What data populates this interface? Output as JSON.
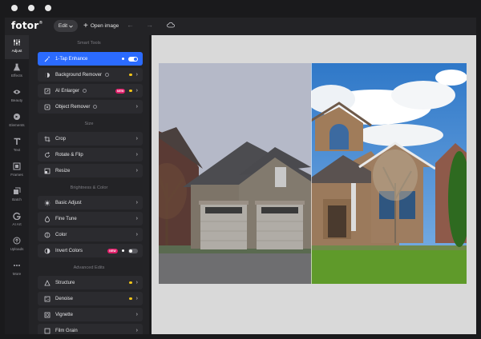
{
  "app": {
    "logo": "fotor",
    "edit_label": "Edit",
    "open_image_label": "Open image"
  },
  "rail": [
    {
      "label": "Adjust",
      "icon": "sliders-icon",
      "active": true
    },
    {
      "label": "Effects",
      "icon": "flask-icon"
    },
    {
      "label": "Beauty",
      "icon": "eye-icon"
    },
    {
      "label": "Elements",
      "icon": "shapes-icon"
    },
    {
      "label": "Text",
      "icon": "text-icon"
    },
    {
      "label": "Frames",
      "icon": "frame-icon"
    },
    {
      "label": "Batch",
      "icon": "batch-icon"
    },
    {
      "label": "AI Art",
      "icon": "ai-art-icon"
    },
    {
      "label": "Uploads",
      "icon": "upload-icon"
    },
    {
      "label": "More",
      "icon": "more-icon"
    }
  ],
  "panel": {
    "smart_tools": "Smart Tools",
    "size": "Size",
    "brightness": "Brightness & Color",
    "advanced": "Advanced Edits",
    "rows": {
      "one_tap": "1-Tap Enhance",
      "bg_remover": "Background Remover",
      "ai_enlarger": "AI Enlarger",
      "object_remover": "Object Remover",
      "crop": "Crop",
      "rotate": "Rotate & Flip",
      "resize": "Resize",
      "basic": "Basic Adjust",
      "fine": "Fine Tune",
      "color": "Color",
      "invert": "Invert Colors",
      "structure": "Structure",
      "denoise": "Denoise",
      "vignette": "Vignette",
      "film": "Film Grain"
    },
    "badge_new": "NEW"
  },
  "colors": {
    "accent": "#2b6bff",
    "premium_dot": "#f5c518",
    "new_badge": "#e0206a"
  }
}
